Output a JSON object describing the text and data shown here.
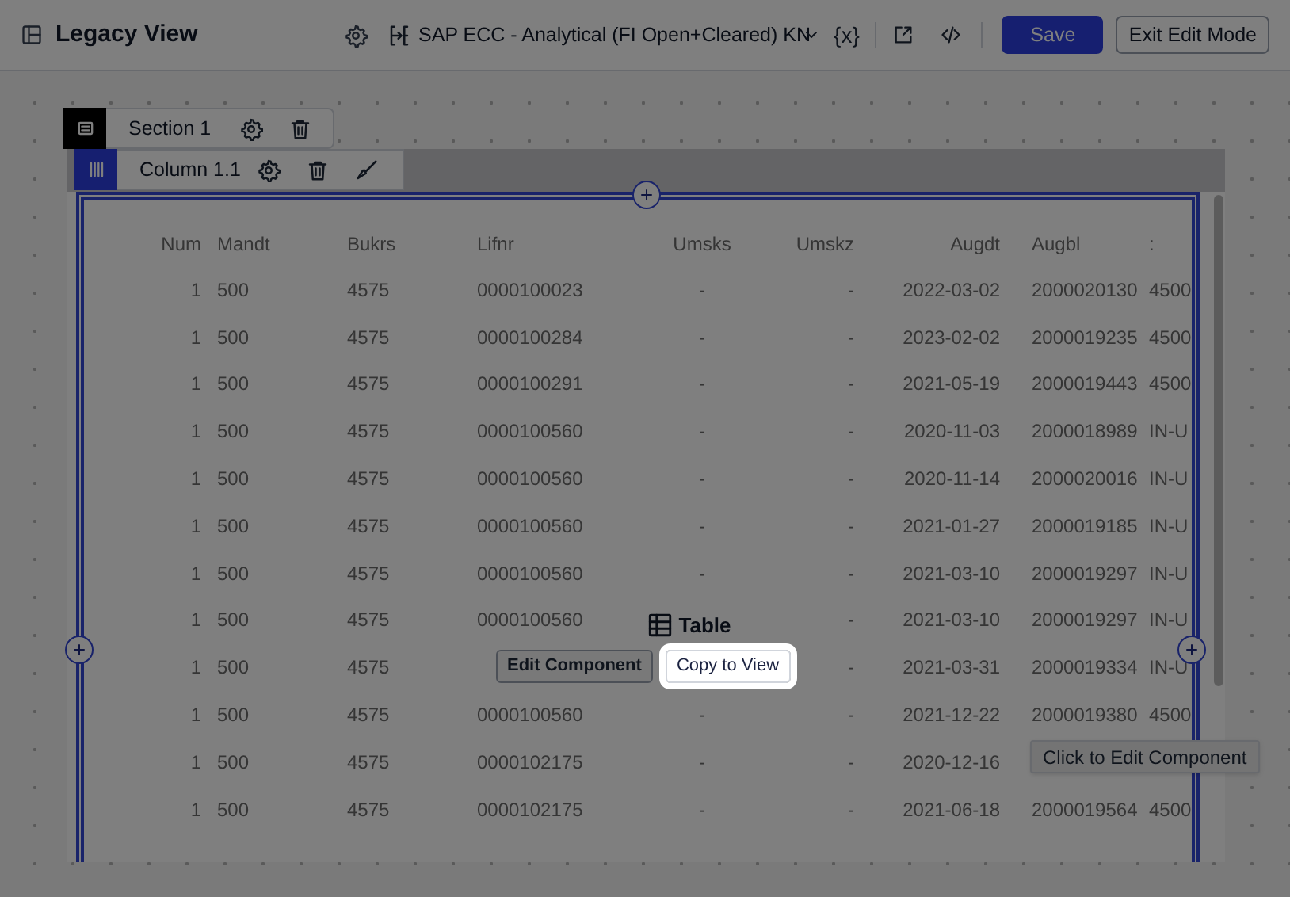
{
  "header": {
    "title": "Legacy View",
    "data_source": "SAP ECC - Analytical (FI Open+Cleared) KN",
    "variables_label": "{x}",
    "buttons": [
      {
        "label": "Save",
        "kind": "primary"
      },
      {
        "label": "Exit Edit Mode",
        "kind": "secondary"
      }
    ]
  },
  "section": {
    "label": "Section 1"
  },
  "column": {
    "label": "Column 1.1"
  },
  "table": {
    "columns": [
      "Num",
      "Mandt",
      "Bukrs",
      "Lifnr",
      "Umsks",
      "Umskz",
      "Augdt",
      "Augbl",
      ":"
    ],
    "rows": [
      [
        "1",
        "500",
        "4575",
        "0000100023",
        "-",
        "-",
        "2022-03-02",
        "2000020130",
        "4500"
      ],
      [
        "1",
        "500",
        "4575",
        "0000100284",
        "-",
        "-",
        "2023-02-02",
        "2000019235",
        "4500"
      ],
      [
        "1",
        "500",
        "4575",
        "0000100291",
        "-",
        "-",
        "2021-05-19",
        "2000019443",
        "4500"
      ],
      [
        "1",
        "500",
        "4575",
        "0000100560",
        "-",
        "-",
        "2020-11-03",
        "2000018989",
        "IN-U"
      ],
      [
        "1",
        "500",
        "4575",
        "0000100560",
        "-",
        "-",
        "2020-11-14",
        "2000020016",
        "IN-U"
      ],
      [
        "1",
        "500",
        "4575",
        "0000100560",
        "-",
        "-",
        "2021-01-27",
        "2000019185",
        "IN-U"
      ],
      [
        "1",
        "500",
        "4575",
        "0000100560",
        "-",
        "-",
        "2021-03-10",
        "2000019297",
        "IN-U"
      ],
      [
        "1",
        "500",
        "4575",
        "0000100560",
        null,
        "-",
        "2021-03-10",
        "2000019297",
        "IN-U"
      ],
      [
        "1",
        "500",
        "4575",
        null,
        null,
        "-",
        "2021-03-31",
        "2000019334",
        "IN-U"
      ],
      [
        "1",
        "500",
        "4575",
        "0000100560",
        "-",
        "-",
        "2021-12-22",
        "2000019380",
        "4500"
      ],
      [
        "1",
        "500",
        "4575",
        "0000102175",
        "-",
        "-",
        "2020-12-16",
        null,
        null
      ],
      [
        "1",
        "500",
        "4575",
        "0000102175",
        "-",
        "-",
        "2021-06-18",
        "2000019564",
        "4500"
      ]
    ]
  },
  "component": {
    "label": "Table",
    "buttons": [
      {
        "label": "Edit Component",
        "kind": "secondary"
      },
      {
        "label": "Copy to View",
        "kind": "highlight"
      }
    ],
    "tooltip": "Click to Edit Component"
  }
}
